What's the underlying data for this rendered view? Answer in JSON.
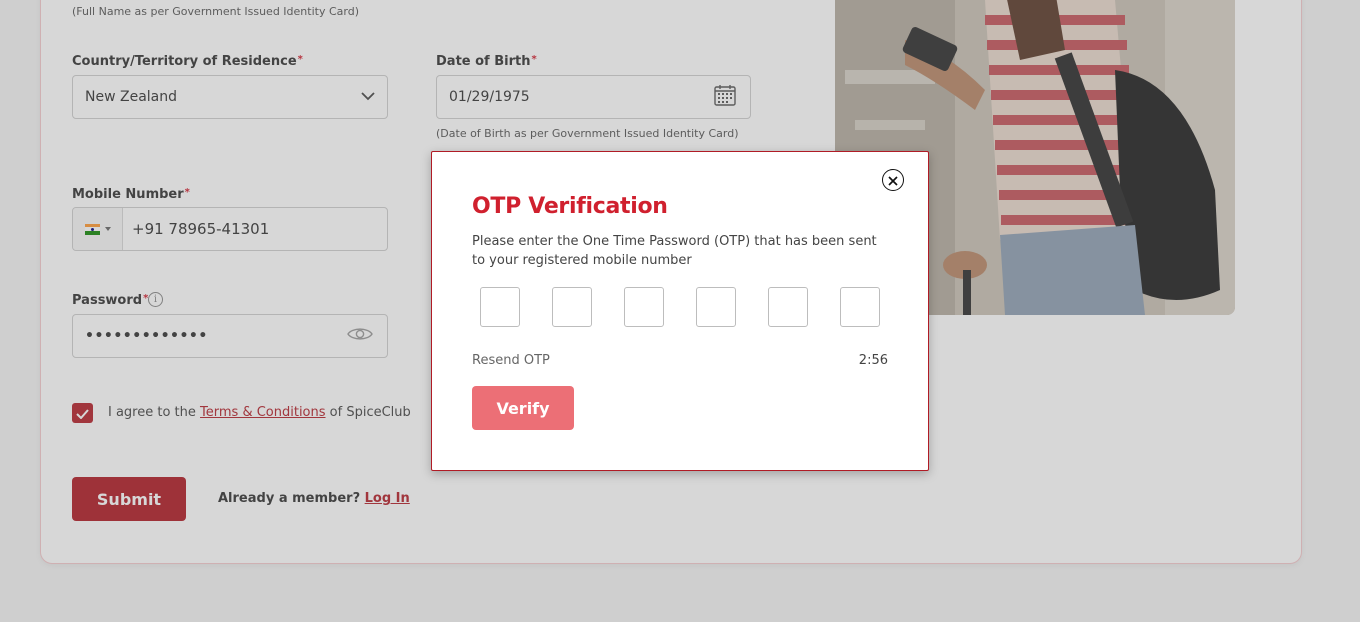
{
  "form": {
    "name_hint": "(Full Name as per Government Issued Identity Card)",
    "country_label": "Country/Territory of Residence",
    "country_value": "New Zealand",
    "dob_label": "Date of Birth",
    "dob_value": "01/29/1975",
    "dob_hint": "(Date of Birth as per Government Issued Identity Card)",
    "mobile_label": "Mobile Number",
    "mobile_value": "+91 78965-41301",
    "password_label": "Password",
    "password_value": "•••••••••••••",
    "required_mark": "*",
    "info_glyph": "i",
    "agree_prefix": "I agree to the ",
    "terms_link": "Terms & Conditions",
    "agree_suffix": " of SpiceClub",
    "submit_label": "Submit",
    "member_prefix": "Already a member? ",
    "login_link": "Log In"
  },
  "modal": {
    "title": "OTP Verification",
    "description": "Please enter the One Time Password (OTP) that has been sent to your registered mobile number",
    "resend_label": "Resend OTP",
    "timer": "2:56",
    "verify_label": "Verify",
    "otp_digits": 6
  },
  "colors": {
    "brand_red": "#b01b25",
    "title_red": "#d0202e",
    "verify_disabled": "#ec6f76"
  },
  "icons": {
    "country_dropdown": "chevron-down-icon",
    "date_picker": "calendar-icon",
    "flag": "india-flag-icon",
    "password_toggle": "eye-icon",
    "password_info": "info-icon",
    "close": "close-icon",
    "checkbox": "checkmark-icon"
  }
}
